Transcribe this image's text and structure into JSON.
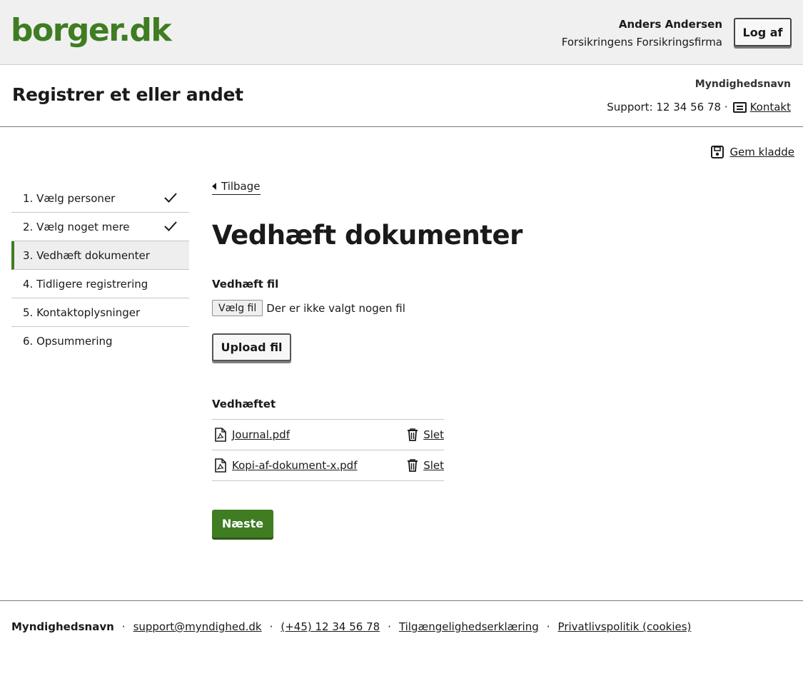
{
  "header": {
    "logo": "borger.dk",
    "user_name": "Anders Andersen",
    "user_org": "Forsikringens Forsikringsfirma",
    "logout_label": "Log af"
  },
  "subheader": {
    "title": "Registrer et eller andet",
    "authority": "Myndighedsnavn",
    "support_text": "Support: 12 34 56 78 ·",
    "contact_label": "Kontakt"
  },
  "save_draft_label": "Gem kladde",
  "steps": [
    {
      "label": "1. Vælg personer",
      "completed": true,
      "active": false
    },
    {
      "label": "2. Vælg noget mere",
      "completed": true,
      "active": false
    },
    {
      "label": "3. Vedhæft dokumenter",
      "completed": false,
      "active": true
    },
    {
      "label": "4. Tidligere registrering",
      "completed": false,
      "active": false
    },
    {
      "label": "5. Kontaktoplysninger",
      "completed": false,
      "active": false
    },
    {
      "label": "6. Opsummering",
      "completed": false,
      "active": false
    }
  ],
  "main": {
    "back_label": "Tilbage",
    "heading": "Vedhæft dokumenter",
    "file_label": "Vedhæft fil",
    "choose_file_label": "Vælg fil",
    "no_file_text": "Der er ikke valgt nogen fil",
    "upload_label": "Upload fil",
    "attached_label": "Vedhæftet",
    "attached": [
      {
        "name": "Journal.pdf",
        "delete_label": "Slet"
      },
      {
        "name": "Kopi-af-dokument-x.pdf",
        "delete_label": "Slet"
      }
    ],
    "next_label": "Næste"
  },
  "footer": {
    "org": "Myndighedsnavn",
    "email": "support@myndighed.dk",
    "phone": "(+45) 12 34 56 78",
    "accessibility": "Tilgængelighedserklæring",
    "privacy": "Privatlivspolitik (cookies)",
    "separator": "·"
  },
  "colors": {
    "brand_green": "#3f7c22",
    "header_bg": "#f0f0f0"
  }
}
